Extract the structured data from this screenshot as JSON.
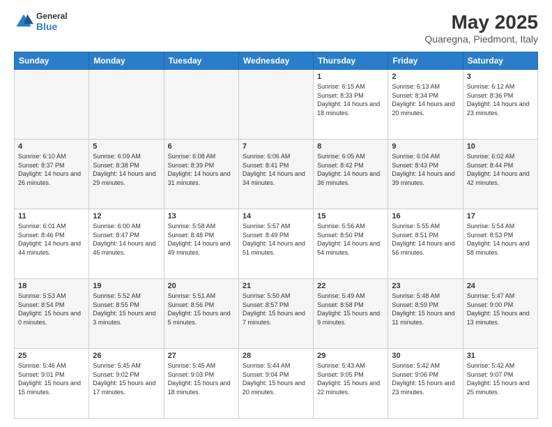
{
  "header": {
    "logo_general": "General",
    "logo_blue": "Blue",
    "title": "May 2025",
    "location": "Quaregna, Piedmont, Italy"
  },
  "weekdays": [
    "Sunday",
    "Monday",
    "Tuesday",
    "Wednesday",
    "Thursday",
    "Friday",
    "Saturday"
  ],
  "weeks": [
    [
      {
        "day": "",
        "empty": true
      },
      {
        "day": "",
        "empty": true
      },
      {
        "day": "",
        "empty": true
      },
      {
        "day": "",
        "empty": true
      },
      {
        "day": "1",
        "sunrise": "6:15 AM",
        "sunset": "8:33 PM",
        "daylight": "14 hours and 18 minutes."
      },
      {
        "day": "2",
        "sunrise": "6:13 AM",
        "sunset": "8:34 PM",
        "daylight": "14 hours and 20 minutes."
      },
      {
        "day": "3",
        "sunrise": "6:12 AM",
        "sunset": "8:36 PM",
        "daylight": "14 hours and 23 minutes."
      }
    ],
    [
      {
        "day": "4",
        "sunrise": "6:10 AM",
        "sunset": "8:37 PM",
        "daylight": "14 hours and 26 minutes."
      },
      {
        "day": "5",
        "sunrise": "6:09 AM",
        "sunset": "8:38 PM",
        "daylight": "14 hours and 29 minutes."
      },
      {
        "day": "6",
        "sunrise": "6:08 AM",
        "sunset": "8:39 PM",
        "daylight": "14 hours and 31 minutes."
      },
      {
        "day": "7",
        "sunrise": "6:06 AM",
        "sunset": "8:41 PM",
        "daylight": "14 hours and 34 minutes."
      },
      {
        "day": "8",
        "sunrise": "6:05 AM",
        "sunset": "8:42 PM",
        "daylight": "14 hours and 36 minutes."
      },
      {
        "day": "9",
        "sunrise": "6:04 AM",
        "sunset": "8:43 PM",
        "daylight": "14 hours and 39 minutes."
      },
      {
        "day": "10",
        "sunrise": "6:02 AM",
        "sunset": "8:44 PM",
        "daylight": "14 hours and 42 minutes."
      }
    ],
    [
      {
        "day": "11",
        "sunrise": "6:01 AM",
        "sunset": "8:46 PM",
        "daylight": "14 hours and 44 minutes."
      },
      {
        "day": "12",
        "sunrise": "6:00 AM",
        "sunset": "8:47 PM",
        "daylight": "14 hours and 46 minutes."
      },
      {
        "day": "13",
        "sunrise": "5:58 AM",
        "sunset": "8:48 PM",
        "daylight": "14 hours and 49 minutes."
      },
      {
        "day": "14",
        "sunrise": "5:57 AM",
        "sunset": "8:49 PM",
        "daylight": "14 hours and 51 minutes."
      },
      {
        "day": "15",
        "sunrise": "5:56 AM",
        "sunset": "8:50 PM",
        "daylight": "14 hours and 54 minutes."
      },
      {
        "day": "16",
        "sunrise": "5:55 AM",
        "sunset": "8:51 PM",
        "daylight": "14 hours and 56 minutes."
      },
      {
        "day": "17",
        "sunrise": "5:54 AM",
        "sunset": "8:53 PM",
        "daylight": "14 hours and 58 minutes."
      }
    ],
    [
      {
        "day": "18",
        "sunrise": "5:53 AM",
        "sunset": "8:54 PM",
        "daylight": "15 hours and 0 minutes."
      },
      {
        "day": "19",
        "sunrise": "5:52 AM",
        "sunset": "8:55 PM",
        "daylight": "15 hours and 3 minutes."
      },
      {
        "day": "20",
        "sunrise": "5:51 AM",
        "sunset": "8:56 PM",
        "daylight": "15 hours and 5 minutes."
      },
      {
        "day": "21",
        "sunrise": "5:50 AM",
        "sunset": "8:57 PM",
        "daylight": "15 hours and 7 minutes."
      },
      {
        "day": "22",
        "sunrise": "5:49 AM",
        "sunset": "8:58 PM",
        "daylight": "15 hours and 9 minutes."
      },
      {
        "day": "23",
        "sunrise": "5:48 AM",
        "sunset": "8:59 PM",
        "daylight": "15 hours and 11 minutes."
      },
      {
        "day": "24",
        "sunrise": "5:47 AM",
        "sunset": "9:00 PM",
        "daylight": "15 hours and 13 minutes."
      }
    ],
    [
      {
        "day": "25",
        "sunrise": "5:46 AM",
        "sunset": "9:01 PM",
        "daylight": "15 hours and 15 minutes."
      },
      {
        "day": "26",
        "sunrise": "5:45 AM",
        "sunset": "9:02 PM",
        "daylight": "15 hours and 17 minutes."
      },
      {
        "day": "27",
        "sunrise": "5:45 AM",
        "sunset": "9:03 PM",
        "daylight": "15 hours and 18 minutes."
      },
      {
        "day": "28",
        "sunrise": "5:44 AM",
        "sunset": "9:04 PM",
        "daylight": "15 hours and 20 minutes."
      },
      {
        "day": "29",
        "sunrise": "5:43 AM",
        "sunset": "9:05 PM",
        "daylight": "15 hours and 22 minutes."
      },
      {
        "day": "30",
        "sunrise": "5:42 AM",
        "sunset": "9:06 PM",
        "daylight": "15 hours and 23 minutes."
      },
      {
        "day": "31",
        "sunrise": "5:42 AM",
        "sunset": "9:07 PM",
        "daylight": "15 hours and 25 minutes."
      }
    ]
  ],
  "labels": {
    "sunrise": "Sunrise: ",
    "sunset": "Sunset: ",
    "daylight": "Daylight: "
  }
}
